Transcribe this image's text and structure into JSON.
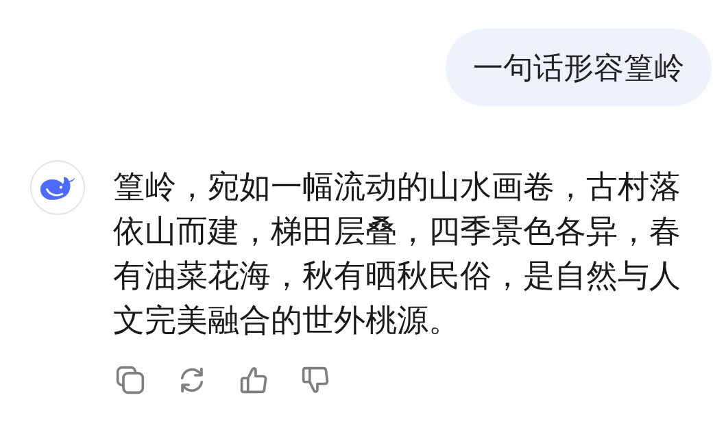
{
  "user_message": {
    "text": "一句话形容篁岭"
  },
  "assistant_message": {
    "text": "篁岭，宛如一幅流动的山水画卷，古村落依山而建，梯田层叠，四季景色各异，春有油菜花海，秋有晒秋民俗，是自然与人文完美融合的世外桃源。"
  }
}
